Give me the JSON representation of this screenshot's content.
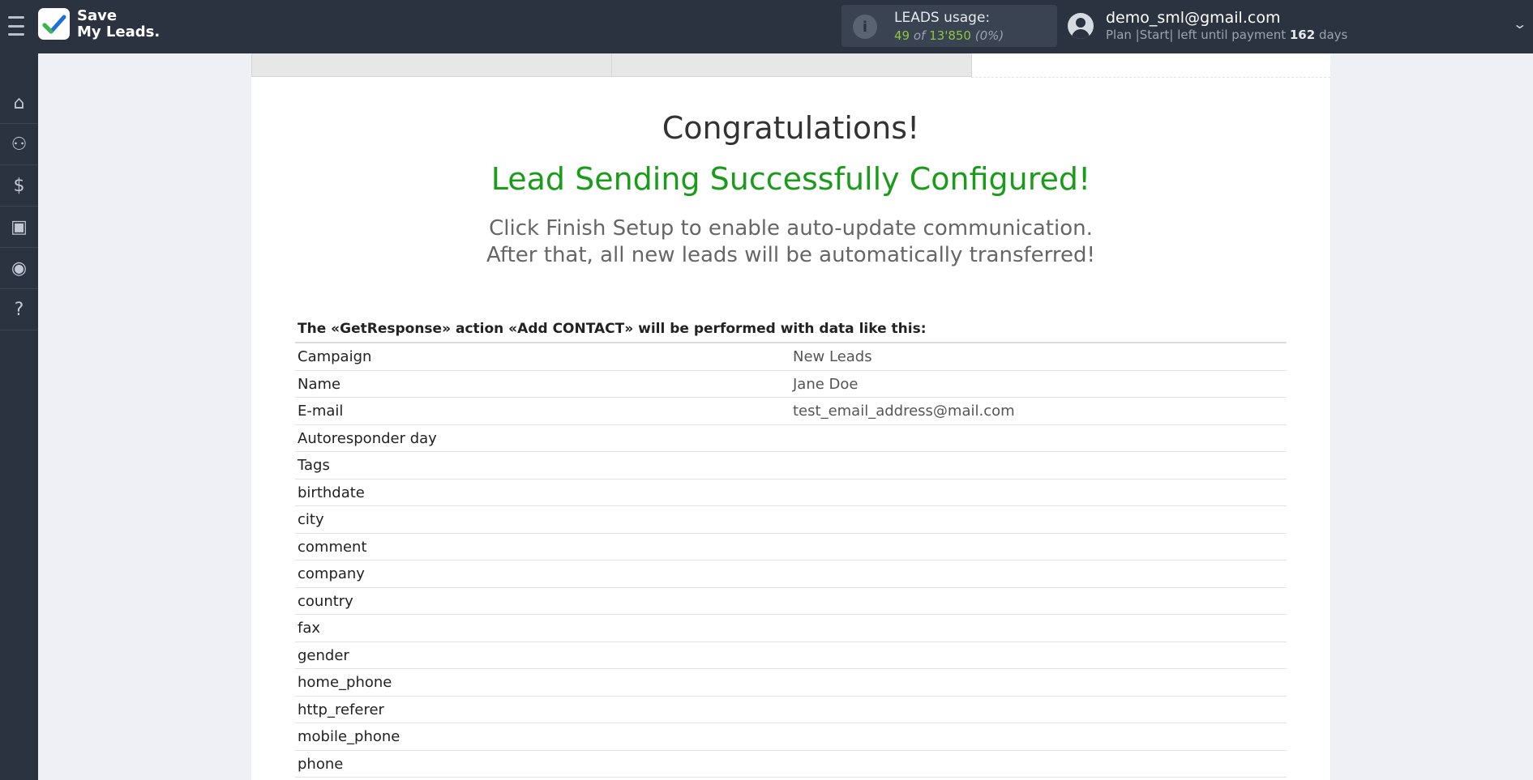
{
  "header": {
    "logo_line1": "Save",
    "logo_line2": "My Leads.",
    "usage_label": "LEADS usage:",
    "usage_used": "49",
    "usage_of": "of",
    "usage_total": "13'850",
    "usage_percent": "(0%)",
    "user_email": "demo_sml@gmail.com",
    "plan_text": "Plan |Start| left until payment",
    "plan_days": "162",
    "plan_days_suffix": "days"
  },
  "sidebar": {
    "items": [
      {
        "icon": "home-icon",
        "glyph": "⌂"
      },
      {
        "icon": "sitemap-icon",
        "glyph": "⚇"
      },
      {
        "icon": "dollar-icon",
        "glyph": "$"
      },
      {
        "icon": "briefcase-icon",
        "glyph": "▣"
      },
      {
        "icon": "user-circle-icon",
        "glyph": "◉"
      },
      {
        "icon": "help-icon",
        "glyph": "?"
      }
    ]
  },
  "main": {
    "title": "Congratulations!",
    "success": "Lead Sending Successfully Configured!",
    "hint_line1": "Click Finish Setup to enable auto-update communication.",
    "hint_line2": "After that, all new leads will be automatically transferred!",
    "table_caption": "The «GetResponse» action «Add CONTACT» will be performed with data like this:",
    "rows": [
      {
        "key": "Campaign",
        "value": "New Leads"
      },
      {
        "key": "Name",
        "value": "Jane Doe"
      },
      {
        "key": "E-mail",
        "value": "test_email_address@mail.com"
      },
      {
        "key": "Autoresponder day",
        "value": ""
      },
      {
        "key": "Tags",
        "value": ""
      },
      {
        "key": "birthdate",
        "value": ""
      },
      {
        "key": "city",
        "value": ""
      },
      {
        "key": "comment",
        "value": ""
      },
      {
        "key": "company",
        "value": ""
      },
      {
        "key": "country",
        "value": ""
      },
      {
        "key": "fax",
        "value": ""
      },
      {
        "key": "gender",
        "value": ""
      },
      {
        "key": "home_phone",
        "value": ""
      },
      {
        "key": "http_referer",
        "value": ""
      },
      {
        "key": "mobile_phone",
        "value": ""
      },
      {
        "key": "phone",
        "value": ""
      }
    ]
  },
  "colors": {
    "topbar": "#2b3340",
    "success_green": "#1a9c1a",
    "usage_green": "#8dc63f"
  }
}
